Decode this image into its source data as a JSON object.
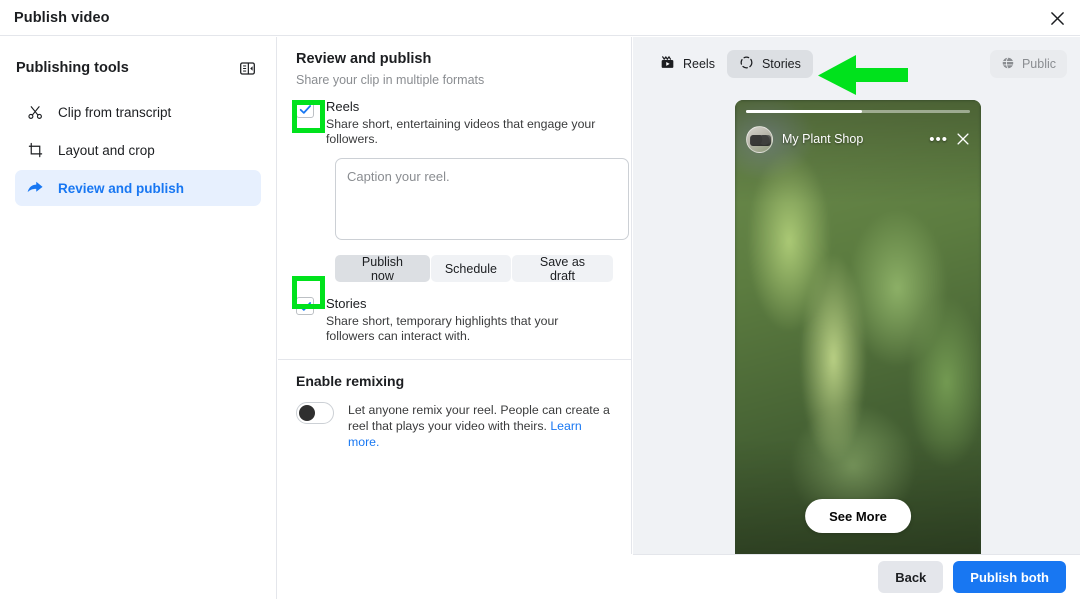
{
  "window": {
    "title": "Publish video",
    "close_icon": "close-icon"
  },
  "sidebar": {
    "heading": "Publishing tools",
    "collapse_icon": "panel-collapse-icon",
    "items": [
      {
        "label": "Clip from transcript",
        "icon": "scissors-icon",
        "active": false
      },
      {
        "label": "Layout and crop",
        "icon": "crop-icon",
        "active": false
      },
      {
        "label": "Review and publish",
        "icon": "share-arrow-icon",
        "active": true
      }
    ]
  },
  "main": {
    "title": "Review and publish",
    "subtitle": "Share your clip in multiple formats",
    "reels": {
      "checkbox_checked": true,
      "name": "Reels",
      "description": "Share short, entertaining videos that engage your followers.",
      "caption_placeholder": "Caption your reel.",
      "caption_value": "",
      "buttons": [
        {
          "label": "Publish now",
          "selected": true
        },
        {
          "label": "Schedule",
          "selected": false
        },
        {
          "label": "Save as draft",
          "selected": false
        }
      ]
    },
    "stories": {
      "checkbox_checked": true,
      "name": "Stories",
      "description": "Share short, temporary highlights that your followers can interact with."
    },
    "remixing": {
      "title": "Enable remixing",
      "toggle_on": false,
      "description": "Let anyone remix your reel. People can create a reel that plays your video with theirs. ",
      "link_label": "Learn more."
    }
  },
  "preview": {
    "tabs": [
      {
        "label": "Reels",
        "icon": "clapperboard-icon",
        "active": false
      },
      {
        "label": "Stories",
        "icon": "dashed-circle-icon",
        "active": true
      }
    ],
    "audience": {
      "label": "Public",
      "icon": "globe-icon"
    },
    "story": {
      "account_name": "My Plant Shop",
      "avatar_icon": "avatar",
      "more_icon": "ellipsis-icon",
      "close_icon": "close-icon",
      "cta_label": "See More",
      "progress_percent": 52
    }
  },
  "footer": {
    "back_label": "Back",
    "publish_label": "Publish both"
  },
  "annotations": {
    "highlight_color": "#00e21c",
    "arrow_direction": "left",
    "targets": [
      "reels-checkbox",
      "stories-checkbox",
      "stories-tab"
    ]
  },
  "colors": {
    "accent_blue": "#1877f2",
    "annotation_green": "#00e21c",
    "panel_gray": "#f0f2f5"
  }
}
